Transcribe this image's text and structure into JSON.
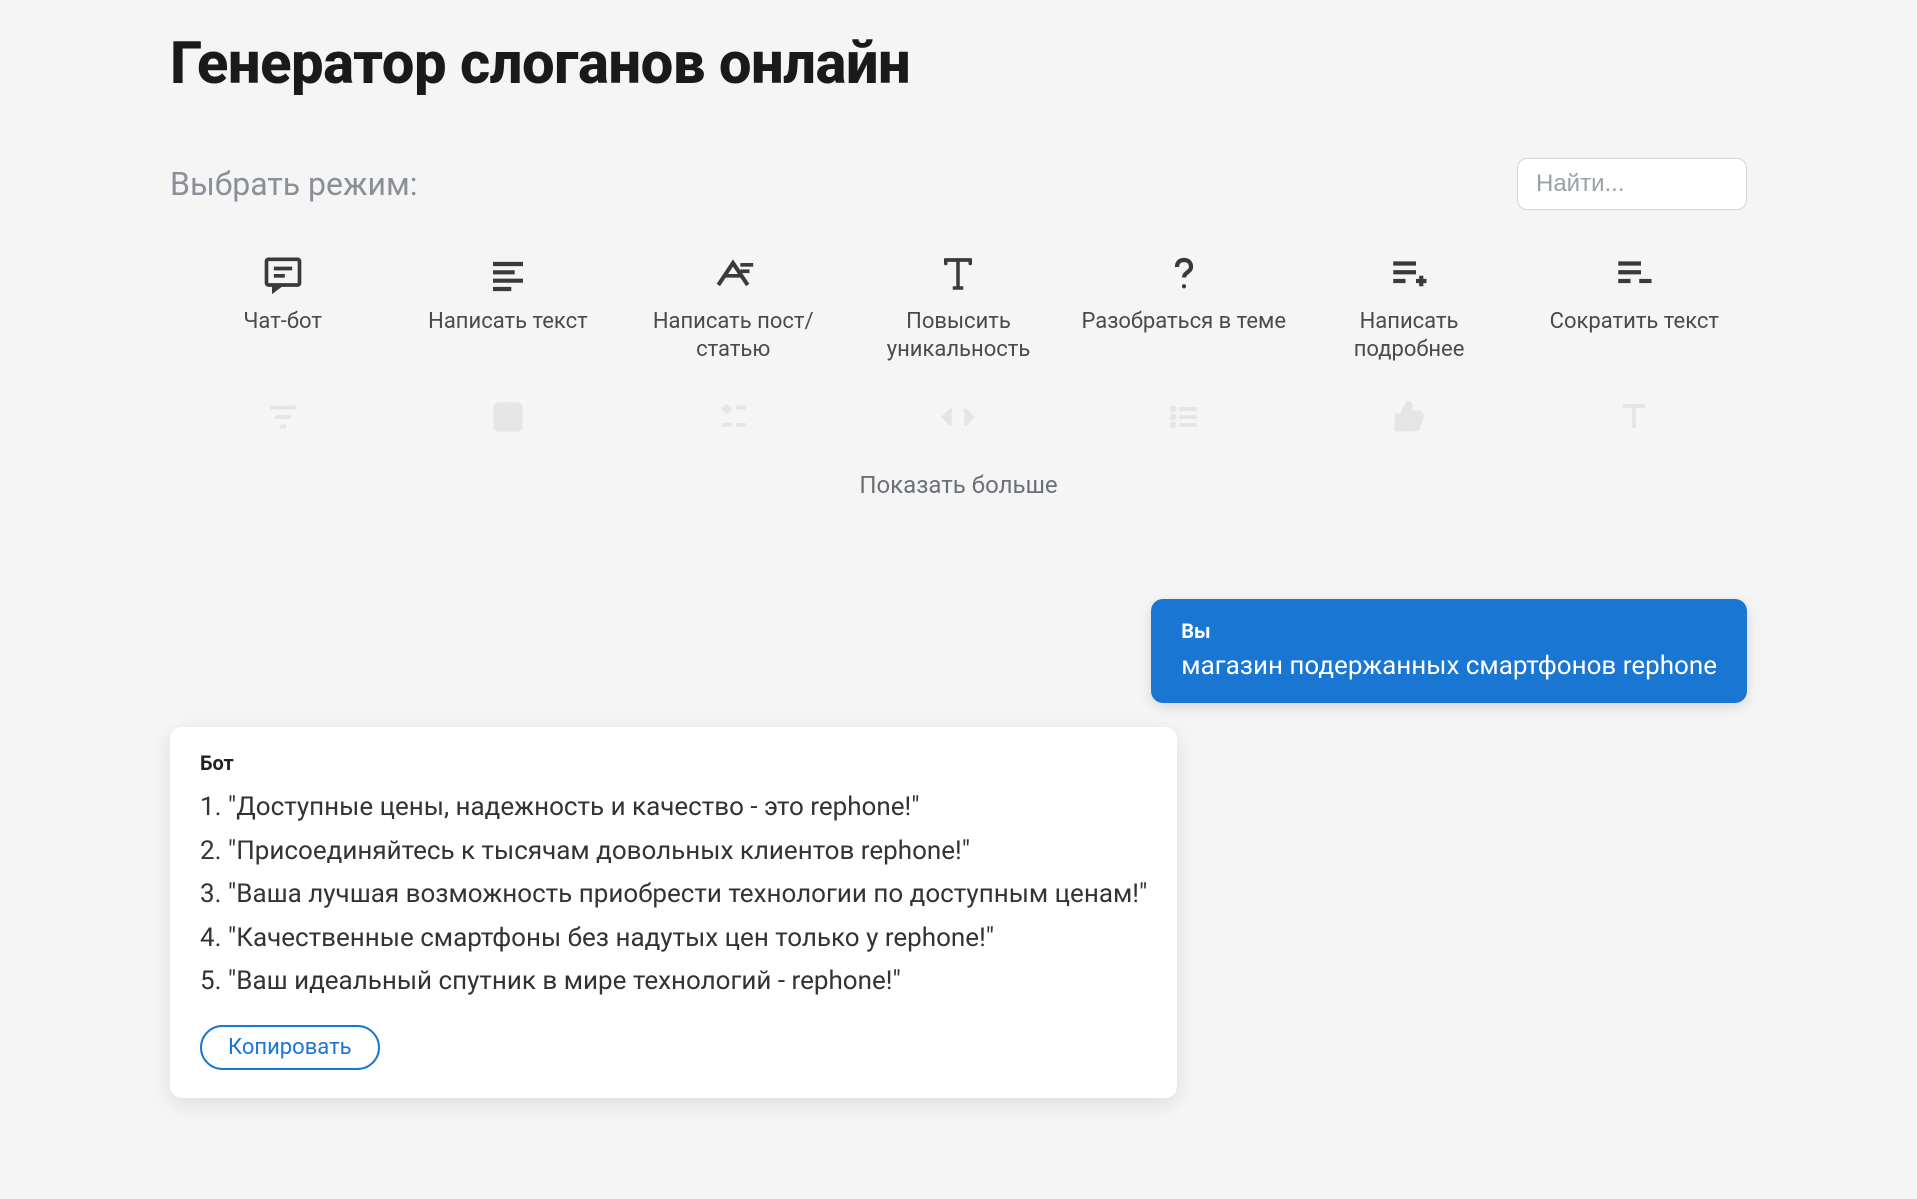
{
  "page": {
    "title": "Генератор слоганов онлайн",
    "mode_select_label": "Выбрать режим:",
    "search_placeholder": "Найти...",
    "show_more": "Показать больше"
  },
  "modes": [
    {
      "id": "chat-bot",
      "icon": "chat-icon",
      "label": "Чат-бот"
    },
    {
      "id": "write-text",
      "icon": "align-left-icon",
      "label": "Написать текст"
    },
    {
      "id": "write-post",
      "icon": "article-icon",
      "label": "Написать пост/статью"
    },
    {
      "id": "uniqueness",
      "icon": "text-t-icon",
      "label": "Повысить уникальность"
    },
    {
      "id": "understand",
      "icon": "question-icon",
      "label": "Разобраться в теме"
    },
    {
      "id": "write-detailed",
      "icon": "list-plus-icon",
      "label": "Написать подробнее"
    },
    {
      "id": "shorten",
      "icon": "list-minus-icon",
      "label": "Сократить текст"
    }
  ],
  "chat": {
    "user": {
      "who": "Вы",
      "text": "магазин подержанных смартфонов rephone"
    },
    "bot": {
      "who": "Бот",
      "lines": [
        "1. \"Доступные цены, надежность и качество - это rephone!\"",
        "2. \"Присоединяйтесь к тысячам довольных клиентов rephone!\"",
        "3. \"Ваша лучшая возможность приобрести технологии по доступным ценам!\"",
        "4. \"Качественные смартфоны без надутых цен только у rephone!\"",
        "5. \"Ваш идеальный спутник в мире технологий - rephone!\""
      ],
      "copy_label": "Копировать"
    }
  }
}
